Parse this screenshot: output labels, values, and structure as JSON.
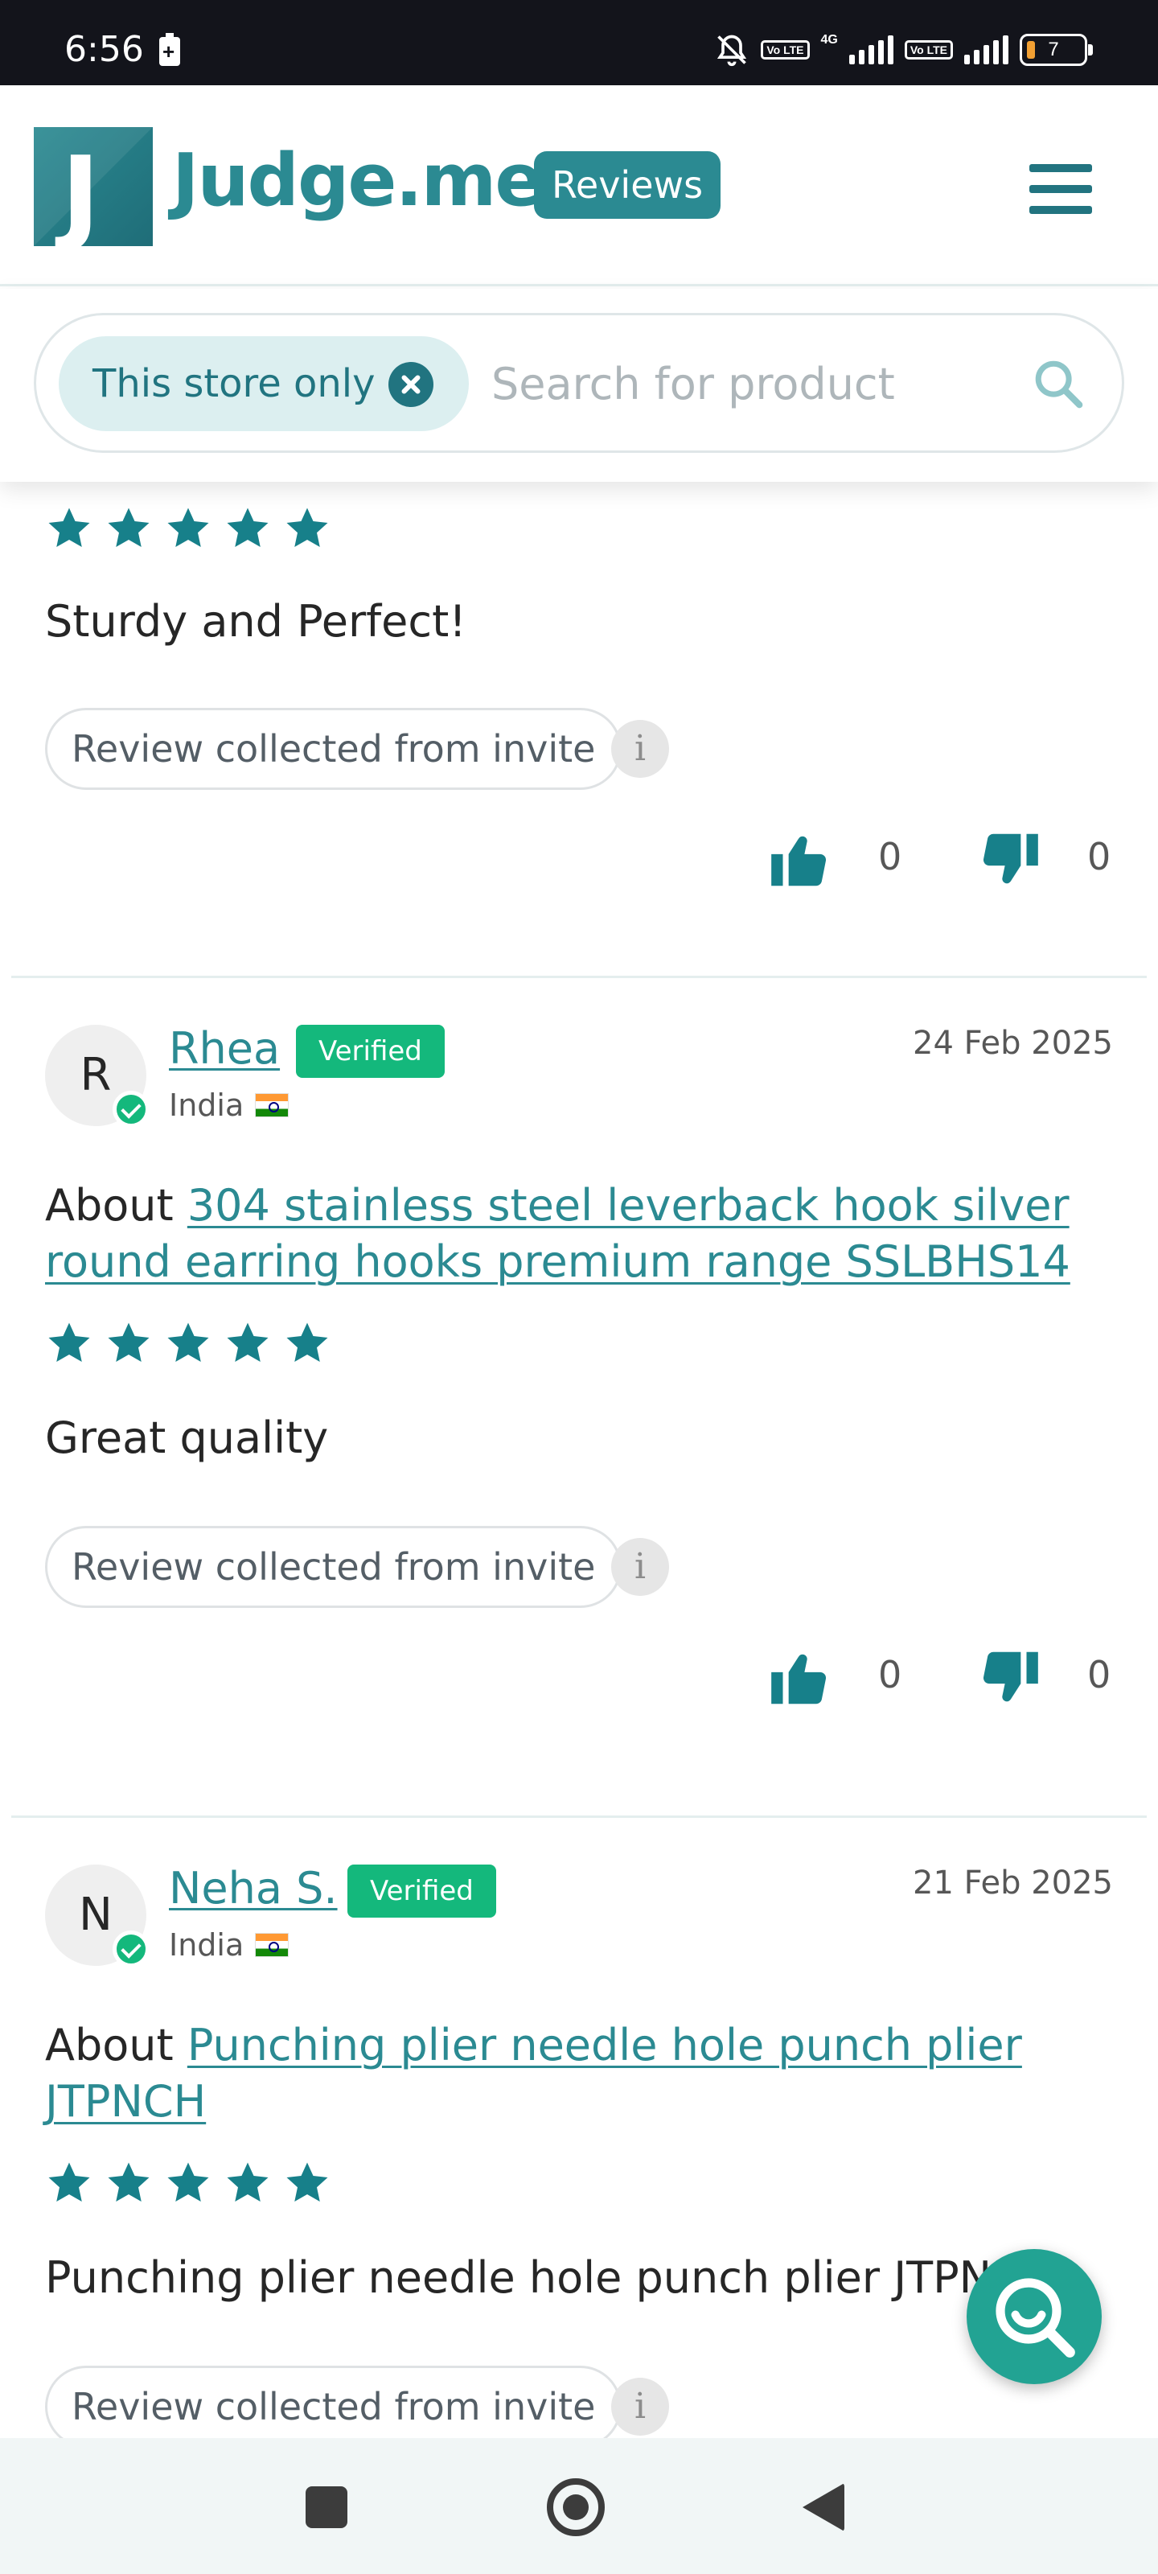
{
  "status_bar": {
    "time": "6:56",
    "battery_level": "7",
    "network_type": "4G",
    "volte_labels": [
      "Vo LTE",
      "Vo LTE"
    ]
  },
  "header": {
    "logo_letter": "J",
    "brand_name": "Judge.me",
    "badge": "Reviews",
    "menu_icon": "hamburger-menu-icon"
  },
  "search": {
    "filter_chip": "This store only",
    "placeholder": "Search for product",
    "value": ""
  },
  "reviews": [
    {
      "stars": 5,
      "text": "Sturdy and Perfect!",
      "collected": "Review collected from invite",
      "helpful": "0",
      "not_helpful": "0"
    },
    {
      "avatar_initial": "R",
      "name": "Rhea",
      "verified": "Verified",
      "country": "India",
      "date": "24 Feb 2025",
      "about_prefix": "About",
      "product": "304 stainless steel leverback hook silver round earring hooks premium range SSLBHS14",
      "stars": 5,
      "text": "Great quality",
      "collected": "Review collected from invite",
      "helpful": "0",
      "not_helpful": "0"
    },
    {
      "avatar_initial": "N",
      "name": "Neha S.",
      "verified": "Verified",
      "country": "India",
      "date": "21 Feb 2025",
      "about_prefix": "About",
      "product": "Punching plier needle hole punch plier JTPNCH",
      "stars": 5,
      "text": "Punching plier needle hole punch plier JTPNCH",
      "collected": "Review collected from invite"
    }
  ],
  "colors": {
    "brand": "#2b8a92",
    "verified": "#14b87c",
    "star": "#17808a",
    "fab": "#22a393"
  }
}
